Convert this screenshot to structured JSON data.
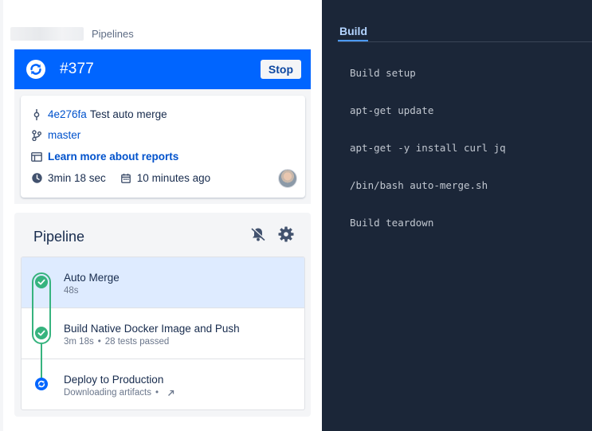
{
  "breadcrumb": {
    "label": "Pipelines"
  },
  "run": {
    "number": "#377",
    "stop_label": "Stop"
  },
  "commit": {
    "hash": "4e276fa",
    "message": "Test auto merge"
  },
  "branch": {
    "name": "master"
  },
  "reports": {
    "link_label": "Learn more about reports"
  },
  "timing": {
    "duration": "3min 18 sec",
    "started": "10 minutes ago"
  },
  "pipeline": {
    "title": "Pipeline",
    "steps": [
      {
        "name": "Auto Merge",
        "detail": "48s",
        "status": "success"
      },
      {
        "name": "Build Native Docker Image and Push",
        "duration": "3m 18s",
        "tests": "28 tests passed",
        "status": "success"
      },
      {
        "name": "Deploy to Production",
        "detail": "Downloading artifacts",
        "status": "in-progress"
      }
    ]
  },
  "log": {
    "tab_label": "Build",
    "commands": [
      "Build setup",
      "apt-get update",
      "apt-get -y install curl jq",
      "/bin/bash auto-merge.sh",
      "Build teardown"
    ]
  },
  "colors": {
    "brand_blue": "#0065ff",
    "success": "#36b37e",
    "log_bg": "#1b2638"
  }
}
